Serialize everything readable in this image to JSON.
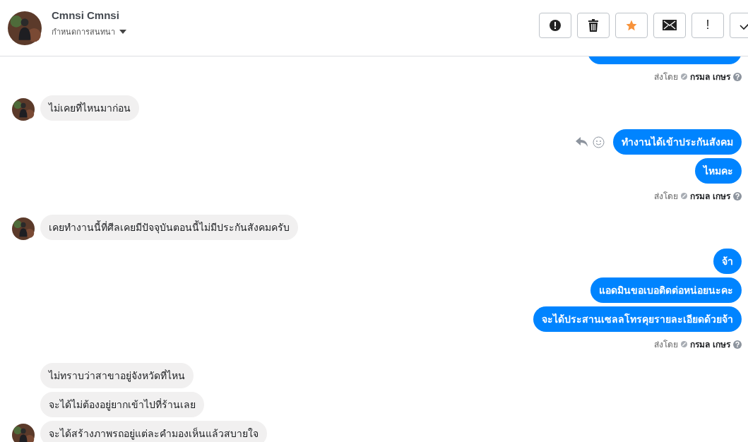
{
  "header": {
    "name": "Cmnsi Cmnsi",
    "subtitle": "กำหนดการสนทนา",
    "buttons": [
      {
        "kind": "alert"
      },
      {
        "kind": "trash"
      },
      {
        "kind": "star"
      },
      {
        "kind": "mail"
      },
      {
        "kind": "text",
        "label": "!"
      },
      {
        "kind": "check"
      }
    ]
  },
  "groups": [
    {
      "outgoing": true,
      "messages": [
        {
          "kind": "cut"
        }
      ],
      "sent_by": {
        "label": "ส่งโดย",
        "name": "กรมล เกษร"
      }
    },
    {
      "outgoing": false,
      "messages": [
        {
          "kind": "text",
          "text": "ไม่เคยที่ไหนมาก่อน"
        }
      ]
    },
    {
      "outgoing": true,
      "messages": [
        {
          "kind": "text",
          "text": "ทำงานได้เข้าประกันสังคม",
          "hover_actions": true
        },
        {
          "kind": "text",
          "text": "ไหมคะ",
          "hover_actions": false
        }
      ],
      "sent_by": {
        "label": "ส่งโดย",
        "name": "กรมล เกษร"
      }
    },
    {
      "outgoing": false,
      "messages": [
        {
          "kind": "text",
          "text": "เคยทำงานนี้ที่ศีลเคยมีปัจจุบันตอนนี้ไม่มีประกันสังคมครับ"
        }
      ]
    },
    {
      "outgoing": true,
      "messages": [
        {
          "kind": "text",
          "text": "จ้า",
          "hover_actions": false
        },
        {
          "kind": "text",
          "text": "แอดมินขอเบอติดต่อหน่อยนะคะ",
          "hover_actions": false
        },
        {
          "kind": "text",
          "text": "จะได้ประสานเซลลโทรคุยรายละเอียดด้วยจ้า",
          "hover_actions": false
        }
      ],
      "sent_by": {
        "label": "ส่งโดย",
        "name": "กรมล เกษร"
      }
    },
    {
      "outgoing": false,
      "messages": [
        {
          "kind": "text",
          "text": "ไม่ทราบว่าสาขาอยู่จังหวัดที่ไหน"
        },
        {
          "kind": "text",
          "text": "จะได้ไม่ต้องอยู่ยากเข้าไปที่ร้านเลย"
        },
        {
          "kind": "text",
          "text": "จะได้สร้างภาพรถอยู่แต่ละคำมองเห็นแล้วสบายใจ"
        }
      ]
    }
  ]
}
